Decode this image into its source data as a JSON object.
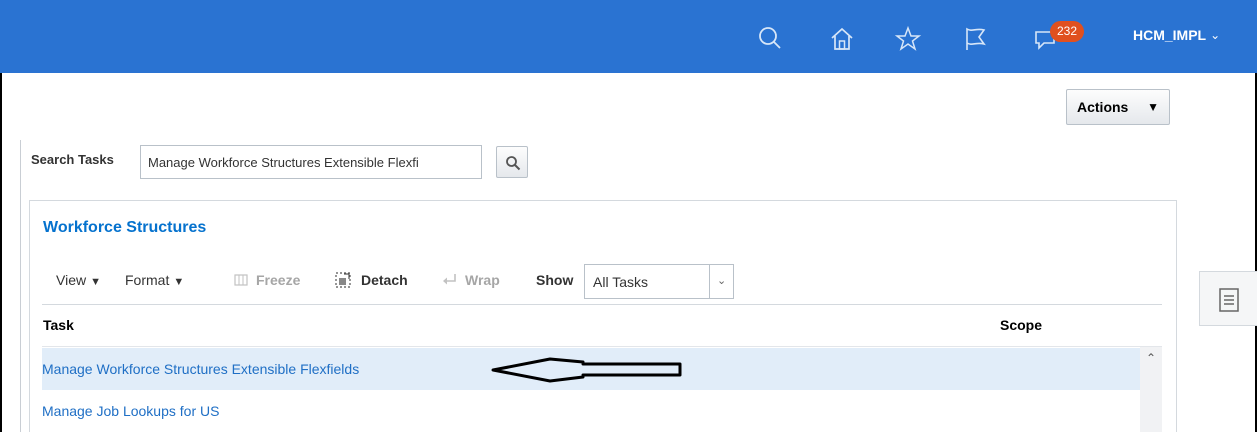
{
  "header": {
    "username": "HCM_IMPL",
    "notification_count": "232",
    "icons": [
      "search-icon",
      "home-icon",
      "star-icon",
      "flag-icon",
      "notifications-icon"
    ],
    "bar_color": "#2a73d2",
    "badge_color": "#e0501f"
  },
  "actions": {
    "label": "Actions"
  },
  "search": {
    "label": "Search Tasks",
    "value": "Manage Workforce Structures Extensible Flexfi"
  },
  "panel": {
    "title": "Workforce Structures",
    "toolbar": {
      "view": "View",
      "format": "Format",
      "freeze": "Freeze",
      "detach": "Detach",
      "wrap": "Wrap",
      "show_label": "Show",
      "show_value": "All Tasks"
    },
    "columns": {
      "task": "Task",
      "scope": "Scope"
    },
    "rows": [
      {
        "task": "Manage Workforce Structures Extensible Flexfields",
        "selected": true
      },
      {
        "task": "Manage Job Lookups for US",
        "selected": false
      }
    ],
    "link_color": "#1f6fc5",
    "selected_row_color": "#e1edf9"
  }
}
